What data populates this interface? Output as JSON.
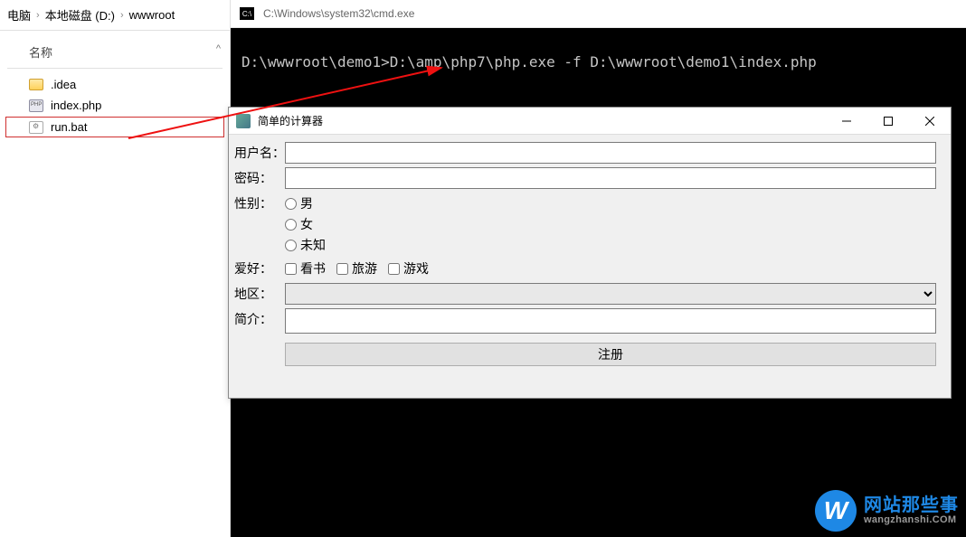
{
  "explorer": {
    "breadcrumb": [
      "电脑",
      "本地磁盘 (D:)",
      "wwwroot"
    ],
    "column_header": "名称",
    "files": [
      {
        "name": ".idea",
        "type": "folder"
      },
      {
        "name": "index.php",
        "type": "php"
      },
      {
        "name": "run.bat",
        "type": "bat",
        "selected": true
      }
    ]
  },
  "cmd": {
    "title": "C:\\Windows\\system32\\cmd.exe",
    "icon_label": "C:\\",
    "line": "D:\\wwwroot\\demo1>D:\\amp\\php7\\php.exe -f D:\\wwwroot\\demo1\\index.php"
  },
  "app": {
    "title": "简单的计算器",
    "labels": {
      "username": "用户名：",
      "password": "密码：",
      "gender": "性别：",
      "hobby": "爱好：",
      "region": "地区：",
      "intro": "简介："
    },
    "gender_options": [
      "男",
      "女",
      "未知"
    ],
    "hobby_options": [
      "看书",
      "旅游",
      "游戏"
    ],
    "register_btn": "注册",
    "username_value": "",
    "password_value": "",
    "intro_value": "",
    "region_value": ""
  },
  "watermark": {
    "logo_letter": "W",
    "cn": "网站那些事",
    "en": "wangzhanshi.COM"
  }
}
